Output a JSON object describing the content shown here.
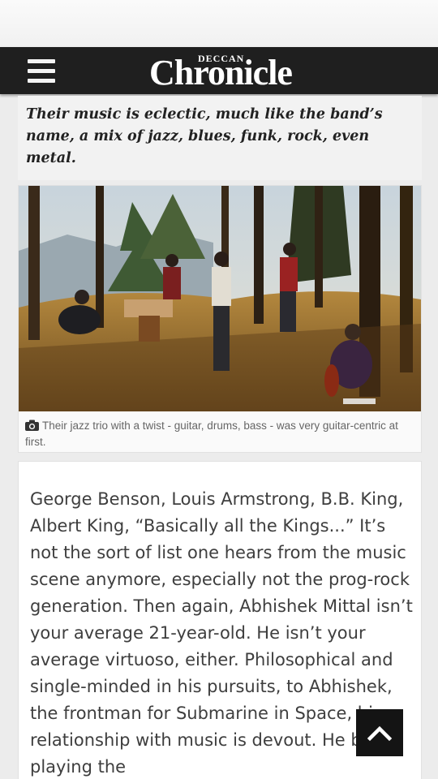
{
  "header": {
    "menu_icon": "hamburger-menu-icon",
    "logo_small": "DECCAN",
    "logo_main": "Chronicle"
  },
  "pull_quote": "Their music is eclectic, much like the band’s name, a mix of jazz, blues, funk, rock, even metal.",
  "photo": {
    "caption_icon": "camera-icon",
    "caption": "Their jazz trio with a twist  - guitar, drums, bass -  was very guitar-centric at first."
  },
  "article": {
    "body": "George Benson, Louis Armstrong, B.B. King, Albert King, “Basically all the Kings...” It’s not the sort of list one hears from the music scene anymore, especially not the prog-rock generation. Then again, Abhishek Mittal isn’t your average 21-year-old. He isn’t your average virtuoso, either. Philosophical and single-minded in his pursuits, to Abhishek, the frontman for Submarine in Space, his relationship with music is devout. He began playing the"
  },
  "scroll_top": {
    "icon": "chevron-up-icon"
  },
  "colors": {
    "header_bg": "#1f1f1f",
    "quote_bg": "#f2f2f2",
    "body_text": "#3e3e3e",
    "caption_text": "#666666"
  }
}
